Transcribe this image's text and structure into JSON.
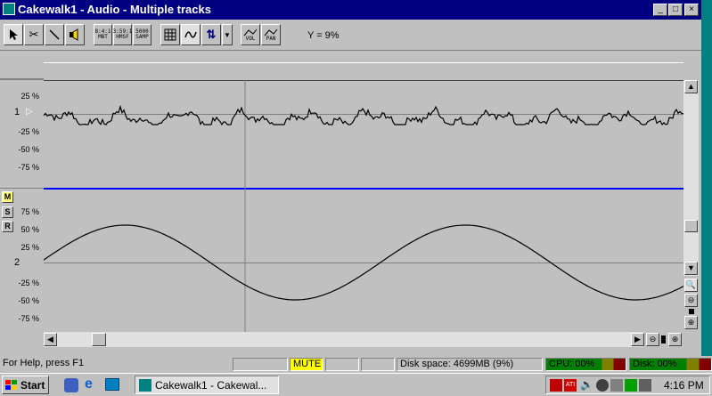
{
  "window": {
    "title": "Cakewalk1 - Audio - Multiple tracks"
  },
  "window_controls": {
    "minimize": "_",
    "maximize": "□",
    "close": "×"
  },
  "toolbar": {
    "mbt": "8:4:1 MBT",
    "hmsf": "3:59:1 HMSF",
    "samp": "5000 SAMP",
    "vol": "VOL",
    "pan": "PAN",
    "readout": "Y = 9%"
  },
  "track1": {
    "number": "1",
    "play_marker": "▷",
    "labels": [
      "25 %",
      "-25 %",
      "-50 %",
      "-75 %"
    ]
  },
  "track2": {
    "number": "2",
    "labels": [
      "75 %",
      "50 %",
      "25 %",
      "-25 %",
      "-50 %",
      "-75 %"
    ],
    "buttons": {
      "mute": "M",
      "solo": "S",
      "record": "R"
    }
  },
  "colors": {
    "titlebar": "#000080",
    "divider": "#0000ff",
    "mute_bg": "#ffff00",
    "cpu_meter": "#008000",
    "cpu_meter_mid": "#808000",
    "cpu_meter_high": "#800000"
  },
  "statusbar": {
    "help": "For Help, press F1",
    "mute": "MUTE",
    "disk_space": "Disk space: 4699MB (9%)",
    "cpu": "CPU: 00%",
    "disk": "Disk: 00%"
  },
  "taskbar": {
    "start": "Start",
    "task_label": "Cakewalk1 - Cakewal...",
    "clock": "4:16 PM"
  }
}
